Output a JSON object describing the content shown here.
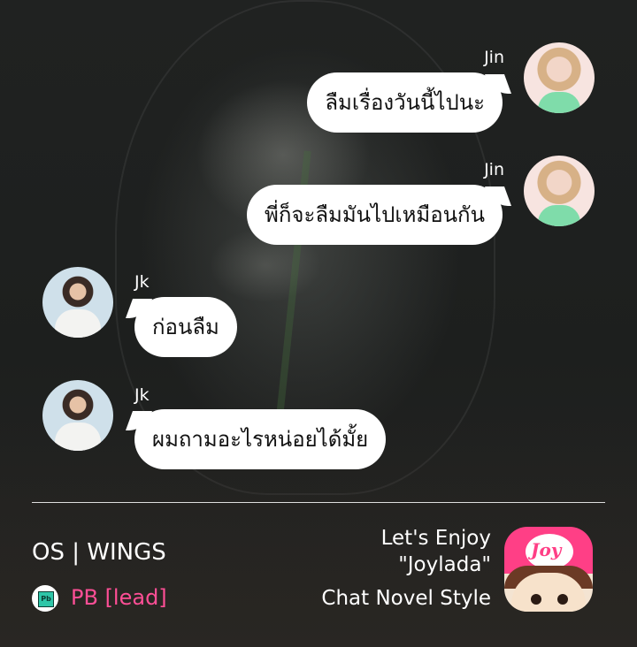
{
  "messages": [
    {
      "sender": "Jin",
      "text": "ลืมเรื่องวันนี้ไปนะ",
      "side": "right"
    },
    {
      "sender": "Jin",
      "text": "พี่ก็จะลืมมันไปเหมือนกัน",
      "side": "right"
    },
    {
      "sender": "Jk",
      "text": "ก่อนลืม",
      "side": "left"
    },
    {
      "sender": "Jk",
      "text": "ผมถามอะไรหน่อยได้มั้ย",
      "side": "left"
    }
  ],
  "footer": {
    "story_title": "OS | WINGS",
    "pb_label": "PB [lead]",
    "promo_line1": "Let's Enjoy",
    "promo_line2": "\"Joylada\"",
    "promo_line3": "Chat Novel Style",
    "logo_text": "Joy"
  },
  "colors": {
    "bubble": "#ffffff",
    "pb_label": "#ff4f96",
    "logo_pink": "#ff3f86"
  },
  "icons": {
    "pb": "pb-badge-icon",
    "logo": "joylada-logo-icon"
  }
}
